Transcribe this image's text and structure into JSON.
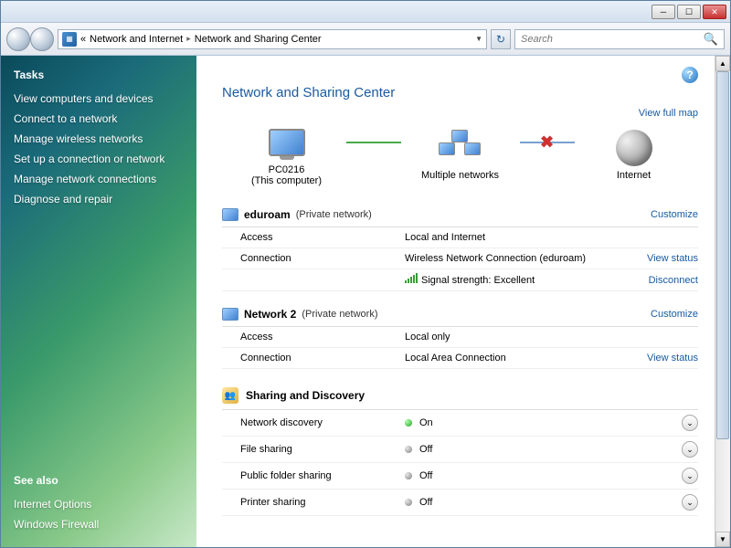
{
  "titlebar": {
    "min": "─",
    "max": "☐",
    "close": "✕"
  },
  "breadcrumb": {
    "back": "«",
    "item1": "Network and Internet",
    "item2": "Network and Sharing Center"
  },
  "search": {
    "placeholder": "Search"
  },
  "sidebar": {
    "tasks_header": "Tasks",
    "tasks": [
      "View computers and devices",
      "Connect to a network",
      "Manage wireless networks",
      "Set up a connection or network",
      "Manage network connections",
      "Diagnose and repair"
    ],
    "see_also_header": "See also",
    "see_also": [
      "Internet Options",
      "Windows Firewall"
    ]
  },
  "page": {
    "title": "Network and Sharing Center",
    "view_full_map": "View full map",
    "map": {
      "node1": "PC0216",
      "node1_sub": "(This computer)",
      "node2": "Multiple networks",
      "node3": "Internet"
    },
    "networks": [
      {
        "name": "eduroam",
        "scope": "(Private network)",
        "customize": "Customize",
        "rows": [
          {
            "label": "Access",
            "value": "Local and Internet"
          },
          {
            "label": "Connection",
            "value": "Wireless Network Connection (eduroam)",
            "link": "View status"
          },
          {
            "label": "",
            "value": "Signal strength:  Excellent",
            "signal": true,
            "link": "Disconnect"
          }
        ]
      },
      {
        "name": "Network  2",
        "scope": "(Private network)",
        "customize": "Customize",
        "rows": [
          {
            "label": "Access",
            "value": "Local only"
          },
          {
            "label": "Connection",
            "value": "Local Area Connection",
            "link": "View status"
          }
        ]
      }
    ],
    "sharing_header": "Sharing and Discovery",
    "sharing": [
      {
        "label": "Network discovery",
        "state": "On",
        "on": true
      },
      {
        "label": "File sharing",
        "state": "Off",
        "on": false
      },
      {
        "label": "Public folder sharing",
        "state": "Off",
        "on": false
      },
      {
        "label": "Printer sharing",
        "state": "Off",
        "on": false
      }
    ]
  }
}
